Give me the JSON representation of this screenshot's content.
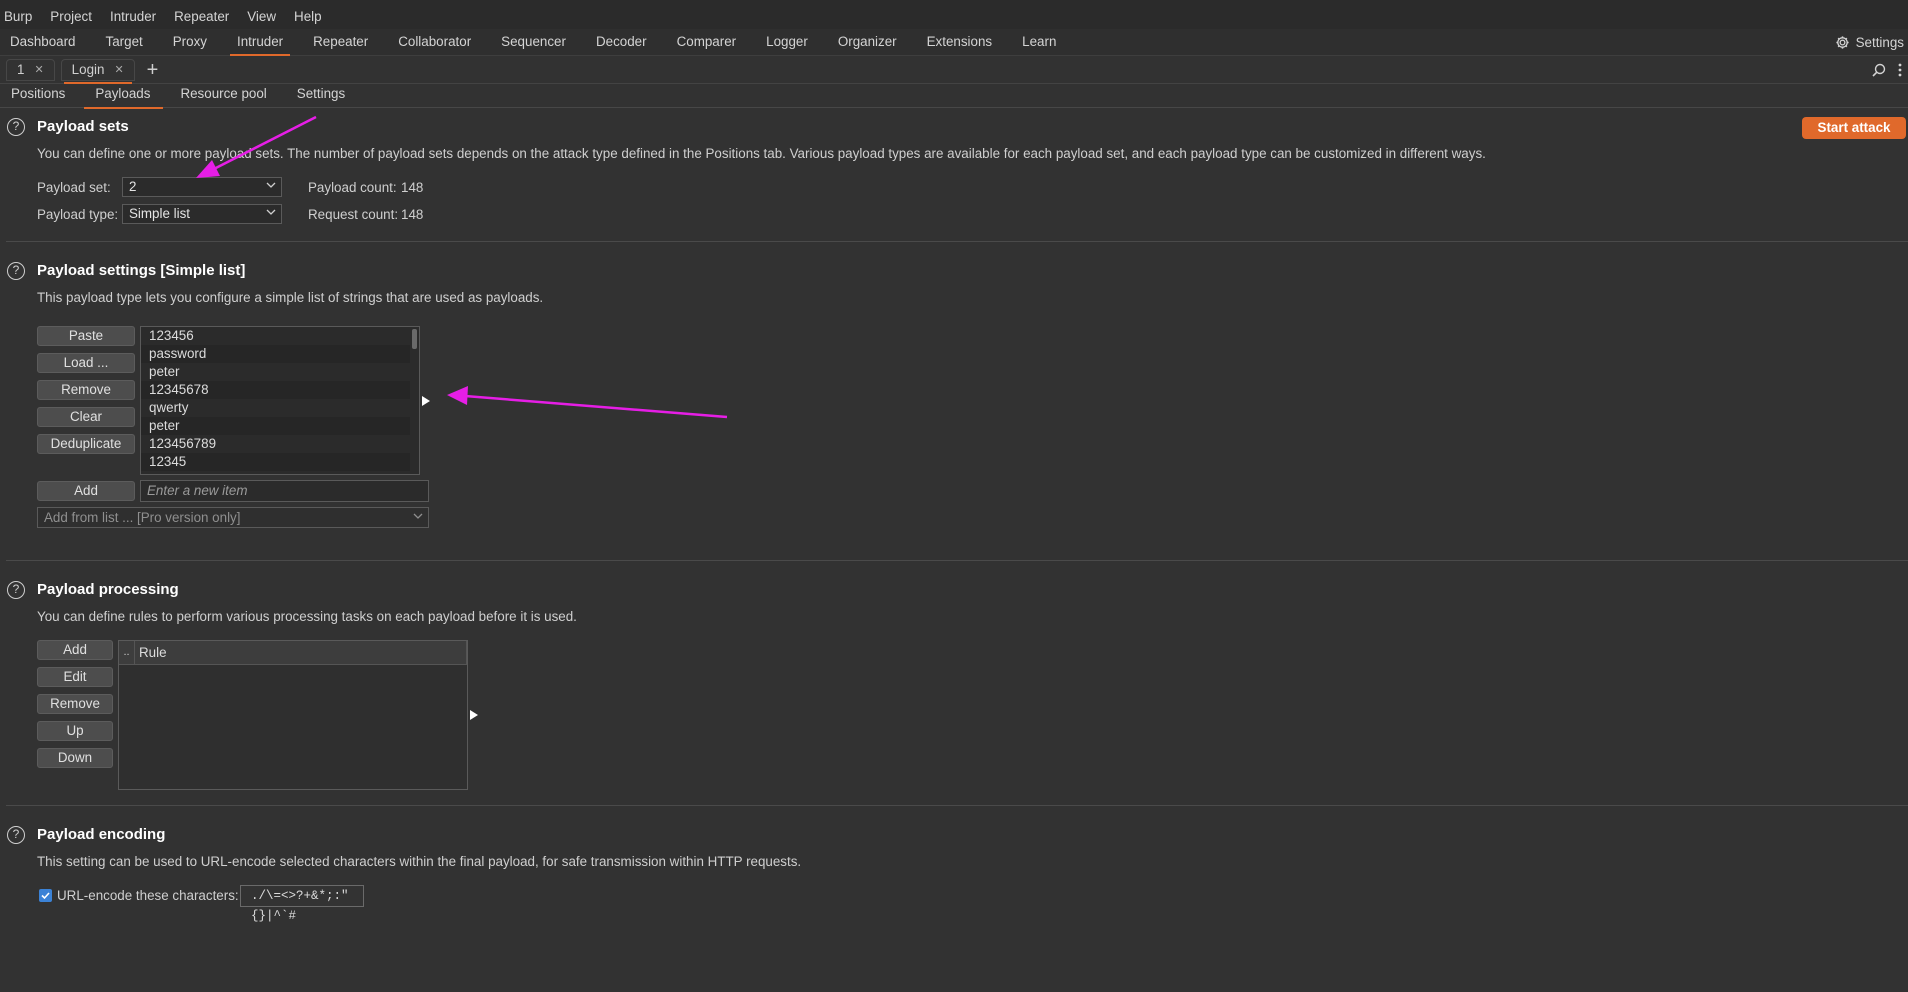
{
  "menubar": [
    "Burp",
    "Project",
    "Intruder",
    "Repeater",
    "View",
    "Help"
  ],
  "tooltabs": [
    "Dashboard",
    "Target",
    "Proxy",
    "Intruder",
    "Repeater",
    "Collaborator",
    "Sequencer",
    "Decoder",
    "Comparer",
    "Logger",
    "Organizer",
    "Extensions",
    "Learn"
  ],
  "tooltab_active": "Intruder",
  "settings_label": "Settings",
  "instance_tabs": [
    {
      "label": "1",
      "active": false
    },
    {
      "label": "Login",
      "active": true
    }
  ],
  "subtabs": [
    "Positions",
    "Payloads",
    "Resource pool",
    "Settings"
  ],
  "subtab_active": "Payloads",
  "start_attack": "Start attack",
  "payload_sets": {
    "title": "Payload sets",
    "description": "You can define one or more payload sets. The number of payload sets depends on the attack type defined in the Positions tab. Various payload types are available for each payload set, and each payload type can be customized in different ways.",
    "set_label": "Payload set:",
    "set_value": "2",
    "type_label": "Payload type:",
    "type_value": "Simple list",
    "payload_count_label": "Payload count:",
    "payload_count": "148",
    "request_count_label": "Request count:",
    "request_count": "148"
  },
  "payload_settings": {
    "title": "Payload settings [Simple list]",
    "description": "This payload type lets you configure a simple list of strings that are used as payloads.",
    "buttons": [
      "Paste",
      "Load ...",
      "Remove",
      "Clear",
      "Deduplicate"
    ],
    "items": [
      "123456",
      "password",
      "peter",
      "12345678",
      "qwerty",
      "peter",
      "123456789",
      "12345"
    ],
    "add_label": "Add",
    "add_placeholder": "Enter a new item",
    "add_from_list": "Add from list ... [Pro version only]"
  },
  "payload_processing": {
    "title": "Payload processing",
    "description": "You can define rules to perform various processing tasks on each payload before it is used.",
    "buttons": [
      "Add",
      "Edit",
      "Remove",
      "Up",
      "Down"
    ],
    "col0": "..",
    "col1": "Rule"
  },
  "payload_encoding": {
    "title": "Payload encoding",
    "description": "This setting can be used to URL-encode selected characters within the final payload, for safe transmission within HTTP requests.",
    "checkbox_label": "URL-encode these characters:",
    "checked": true,
    "chars": "./\\=<>?+&*;:\"{}|^`#"
  },
  "colors": {
    "accent": "#e0692b",
    "annotation": "#e61ee6",
    "background": "#323232"
  }
}
